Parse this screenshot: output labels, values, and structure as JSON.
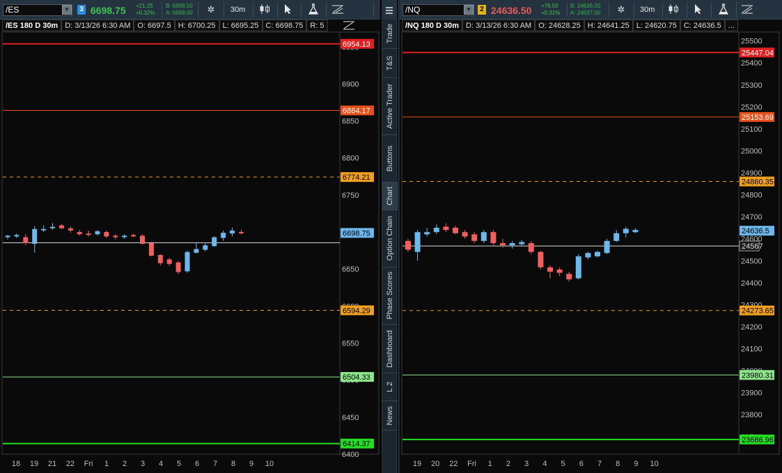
{
  "left": {
    "symbol": "/ES",
    "link_badge": "3",
    "link_color": "#2a8fd8",
    "last_price": "6698.75",
    "last_color": "#3fc24e",
    "change": "+21.25",
    "change_pct": "+0.32%",
    "bid": "B: 6698.50",
    "ask": "A: 6699.00",
    "timeframe": "30m",
    "info": {
      "title": "/ES 180 D 30m",
      "date": "D: 3/13/26 6:30 AM",
      "open": "O: 6697.5",
      "high": "H: 6700.25",
      "low": "L: 6695.25",
      "close": "C: 6698.75",
      "range": "R: 5"
    },
    "y_ticks": [
      "6950",
      "6900",
      "6850",
      "6800",
      "6750",
      "6700",
      "6650",
      "6600",
      "6550",
      "6500",
      "6450",
      "6400"
    ],
    "x_labels": [
      "18",
      "19",
      "21",
      "22",
      "Fri",
      "1",
      "2",
      "3",
      "4",
      "5",
      "6",
      "7",
      "8",
      "9",
      "10"
    ],
    "levels": [
      {
        "label": "6954.13",
        "value": 6954.13,
        "color": "#e02020",
        "bg": "#e02020",
        "fg": "#ffffff",
        "style": "solid",
        "width": 2
      },
      {
        "label": "6864.17",
        "value": 6864.17,
        "color": "#e8501a",
        "bg": "#e8501a",
        "fg": "#ffffff",
        "style": "solid",
        "width": 1
      },
      {
        "label": "6774.21",
        "value": 6774.21,
        "color": "#f0a020",
        "bg": "#f0a020",
        "fg": "#000000",
        "style": "dashed",
        "width": 1
      },
      {
        "label": "6594.29",
        "value": 6594.29,
        "color": "#f0a020",
        "bg": "#f0a020",
        "fg": "#000000",
        "style": "dashed",
        "width": 1
      },
      {
        "label": "6504.33",
        "value": 6504.33,
        "color": "#8ee68a",
        "bg": "#8ee68a",
        "fg": "#000000",
        "style": "solid",
        "width": 1
      },
      {
        "label": "6414.37",
        "value": 6414.37,
        "color": "#22dd22",
        "bg": "#22dd22",
        "fg": "#000000",
        "style": "solid",
        "width": 2
      }
    ],
    "ref_line": {
      "value": 6685.5
    },
    "price_bubble": {
      "label": "6698.75",
      "value": 6698.75
    },
    "candles": [
      {
        "o": 6693,
        "h": 6696,
        "l": 6690,
        "c": 6695
      },
      {
        "o": 6694,
        "h": 6698,
        "l": 6692,
        "c": 6696
      },
      {
        "o": 6693,
        "h": 6697,
        "l": 6682,
        "c": 6685
      },
      {
        "o": 6684,
        "h": 6708,
        "l": 6672,
        "c": 6704
      },
      {
        "o": 6703,
        "h": 6709,
        "l": 6700,
        "c": 6704
      },
      {
        "o": 6705,
        "h": 6712,
        "l": 6703,
        "c": 6707
      },
      {
        "o": 6709,
        "h": 6711,
        "l": 6704,
        "c": 6705
      },
      {
        "o": 6705,
        "h": 6707,
        "l": 6699,
        "c": 6702
      },
      {
        "o": 6700,
        "h": 6703,
        "l": 6695,
        "c": 6697
      },
      {
        "o": 6698,
        "h": 6702,
        "l": 6694,
        "c": 6696
      },
      {
        "o": 6697,
        "h": 6703,
        "l": 6695,
        "c": 6701
      },
      {
        "o": 6700,
        "h": 6702,
        "l": 6692,
        "c": 6694
      },
      {
        "o": 6695,
        "h": 6697,
        "l": 6690,
        "c": 6693
      },
      {
        "o": 6693,
        "h": 6697,
        "l": 6691,
        "c": 6695
      },
      {
        "o": 6696,
        "h": 6698,
        "l": 6693,
        "c": 6695
      },
      {
        "o": 6695,
        "h": 6697,
        "l": 6683,
        "c": 6684
      },
      {
        "o": 6685,
        "h": 6687,
        "l": 6667,
        "c": 6668
      },
      {
        "o": 6669,
        "h": 6670,
        "l": 6655,
        "c": 6658
      },
      {
        "o": 6663,
        "h": 6665,
        "l": 6654,
        "c": 6657
      },
      {
        "o": 6659,
        "h": 6661,
        "l": 6643,
        "c": 6646
      },
      {
        "o": 6647,
        "h": 6675,
        "l": 6645,
        "c": 6673
      },
      {
        "o": 6672,
        "h": 6685,
        "l": 6671,
        "c": 6677
      },
      {
        "o": 6676,
        "h": 6686,
        "l": 6674,
        "c": 6682
      },
      {
        "o": 6681,
        "h": 6694,
        "l": 6680,
        "c": 6693
      },
      {
        "o": 6692,
        "h": 6702,
        "l": 6688,
        "c": 6699
      },
      {
        "o": 6698,
        "h": 6706,
        "l": 6694,
        "c": 6702
      },
      {
        "o": 6700,
        "h": 6703,
        "l": 6697,
        "c": 6699
      }
    ],
    "y_range": [
      6400,
      6970
    ]
  },
  "right": {
    "symbol": "/NQ",
    "link_badge": "2",
    "link_color": "#e3b21c",
    "last_price": "24636.50",
    "last_color": "#e65a5a",
    "change": "+76.50",
    "change_pct": "+0.31%",
    "bid": "B: 24636.00",
    "ask": "A: 24637.00",
    "timeframe": "30m",
    "info": {
      "title": "/NQ 180 D 30m",
      "date": "D: 3/13/26 6:30 AM",
      "open": "O: 24628.25",
      "high": "H: 24641.25",
      "low": "L: 24620.75",
      "close": "C: 24636.5",
      "range": "..."
    },
    "y_ticks": [
      "25500",
      "25400",
      "25300",
      "25200",
      "25100",
      "25000",
      "24900",
      "24800",
      "24700",
      "24600",
      "24500",
      "24400",
      "24300",
      "24200",
      "24100",
      "24000",
      "23900",
      "23800",
      "23700"
    ],
    "x_labels": [
      "19",
      "20",
      "22",
      "Fri",
      "1",
      "2",
      "3",
      "4",
      "5",
      "6",
      "7",
      "8",
      "9",
      "10"
    ],
    "levels": [
      {
        "label": "25447.04",
        "value": 25447.04,
        "color": "#e02020",
        "bg": "#e02020",
        "fg": "#ffffff",
        "style": "solid",
        "width": 2
      },
      {
        "label": "25153.69",
        "value": 25153.69,
        "color": "#e8501a",
        "bg": "#e8501a",
        "fg": "#ffffff",
        "style": "solid",
        "width": 1
      },
      {
        "label": "24860.35",
        "value": 24860.35,
        "color": "#f0a020",
        "bg": "#f0a020",
        "fg": "#000000",
        "style": "dashed",
        "width": 1
      },
      {
        "label": "24273.65",
        "value": 24273.65,
        "color": "#f0a020",
        "bg": "#f0a020",
        "fg": "#000000",
        "style": "dashed",
        "width": 1
      },
      {
        "label": "23980.31",
        "value": 23980.31,
        "color": "#8ee68a",
        "bg": "#8ee68a",
        "fg": "#000000",
        "style": "solid",
        "width": 1
      },
      {
        "label": "23686.96",
        "value": 23686.96,
        "color": "#22dd22",
        "bg": "#22dd22",
        "fg": "#000000",
        "style": "solid",
        "width": 2
      }
    ],
    "ref_line": {
      "value": 24567
    },
    "ref_bubble": {
      "label": "24567",
      "value": 24567
    },
    "price_bubble": {
      "label": "24636.5",
      "value": 24636.5
    },
    "candles": [
      {
        "o": 24590,
        "h": 24600,
        "l": 24540,
        "c": 24550
      },
      {
        "o": 24540,
        "h": 24640,
        "l": 24500,
        "c": 24630
      },
      {
        "o": 24620,
        "h": 24650,
        "l": 24610,
        "c": 24630
      },
      {
        "o": 24630,
        "h": 24665,
        "l": 24620,
        "c": 24650
      },
      {
        "o": 24655,
        "h": 24670,
        "l": 24630,
        "c": 24640
      },
      {
        "o": 24650,
        "h": 24660,
        "l": 24620,
        "c": 24625
      },
      {
        "o": 24630,
        "h": 24640,
        "l": 24600,
        "c": 24610
      },
      {
        "o": 24620,
        "h": 24630,
        "l": 24580,
        "c": 24590
      },
      {
        "o": 24590,
        "h": 24640,
        "l": 24580,
        "c": 24630
      },
      {
        "o": 24630,
        "h": 24640,
        "l": 24570,
        "c": 24580
      },
      {
        "o": 24580,
        "h": 24600,
        "l": 24560,
        "c": 24570
      },
      {
        "o": 24570,
        "h": 24590,
        "l": 24555,
        "c": 24580
      },
      {
        "o": 24575,
        "h": 24595,
        "l": 24565,
        "c": 24585
      },
      {
        "o": 24580,
        "h": 24590,
        "l": 24530,
        "c": 24540
      },
      {
        "o": 24540,
        "h": 24545,
        "l": 24460,
        "c": 24470
      },
      {
        "o": 24470,
        "h": 24480,
        "l": 24420,
        "c": 24450
      },
      {
        "o": 24460,
        "h": 24470,
        "l": 24430,
        "c": 24445
      },
      {
        "o": 24440,
        "h": 24450,
        "l": 24405,
        "c": 24415
      },
      {
        "o": 24420,
        "h": 24530,
        "l": 24415,
        "c": 24520
      },
      {
        "o": 24515,
        "h": 24540,
        "l": 24505,
        "c": 24535
      },
      {
        "o": 24520,
        "h": 24545,
        "l": 24515,
        "c": 24540
      },
      {
        "o": 24535,
        "h": 24600,
        "l": 24530,
        "c": 24590
      },
      {
        "o": 24590,
        "h": 24640,
        "l": 24585,
        "c": 24625
      },
      {
        "o": 24625,
        "h": 24655,
        "l": 24605,
        "c": 24645
      },
      {
        "o": 24630,
        "h": 24648,
        "l": 24625,
        "c": 24640
      }
    ],
    "y_range": [
      23620,
      25540
    ]
  },
  "side_tabs": [
    "Trade",
    "T&S",
    "Active Trader",
    "Buttons",
    "Chart",
    "Option Chain",
    "Phase Scores",
    "Dashboard",
    "L 2",
    "News"
  ],
  "active_tab": "Chart",
  "colors": {
    "up": "#6cb7ec",
    "down": "#ef5f60",
    "ref": "#d8d8d8",
    "axis_text": "#bfbfbf"
  },
  "icons": [
    "gear-icon",
    "candlestick-style-icon",
    "cursor-icon",
    "flask-icon",
    "drawing-icon",
    "menu-icon",
    "chevron-down-icon"
  ]
}
